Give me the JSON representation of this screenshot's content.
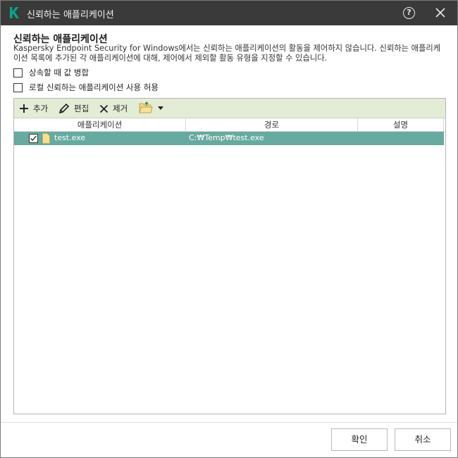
{
  "window": {
    "title": "신뢰하는 애플리케이션",
    "help_glyph": "?"
  },
  "header": {
    "title": "신뢰하는 애플리케이션",
    "description": "Kaspersky Endpoint Security for Windows에서는 신뢰하는 애플리케이션의 활동을 제어하지 않습니다. 신뢰하는 애플리케이션 목록에 추가된 각 애플리케이션에 대해, 제어에서 제외할 활동 유형을 지정할 수 있습니다."
  },
  "options": {
    "merge_on_inherit": {
      "label": "상속할 때 값 병합",
      "checked": false
    },
    "allow_local": {
      "label": "로컬 신뢰하는 애플리케이션 사용 허용",
      "checked": false
    }
  },
  "toolbar": {
    "add_label": "추가",
    "edit_label": "편집",
    "remove_label": "제거",
    "folder_icon": "folder-icon",
    "dropdown_icon": "caret-down-icon"
  },
  "table": {
    "columns": [
      "애플리케이션",
      "경로",
      "설명"
    ],
    "rows": [
      {
        "checked": true,
        "name": "test.exe",
        "path": "C:₩Temp₩test.exe",
        "description": "",
        "selected": true
      }
    ]
  },
  "footer": {
    "ok_label": "확인",
    "cancel_label": "취소"
  },
  "colors": {
    "titlebar": "#3a3a3a",
    "brand": "#00a88e",
    "toolbar": "#e3ecd5",
    "selection": "#65ab9f"
  }
}
